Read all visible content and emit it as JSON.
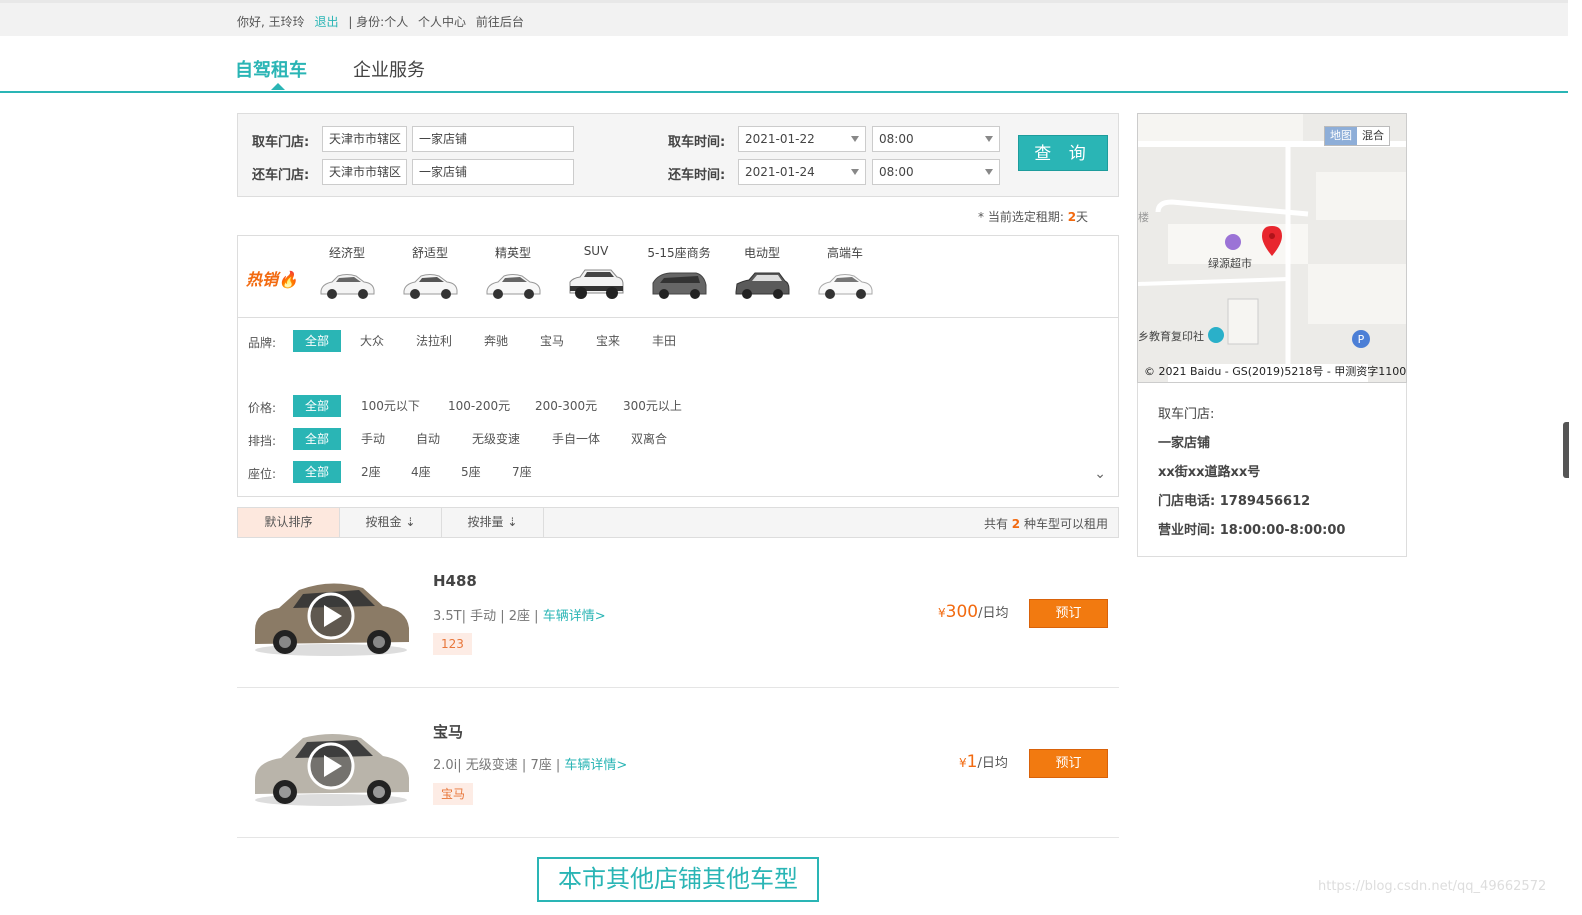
{
  "topbar": {
    "greeting": "你好, 王玲玲",
    "logout": "退出",
    "identity": "| 身份:个人",
    "personal_center": "个人中心",
    "backend": "前往后台"
  },
  "nav": {
    "tabs": [
      {
        "label": "自驾租车",
        "active": true
      },
      {
        "label": "企业服务",
        "active": false
      }
    ]
  },
  "search": {
    "pickup_store_label": "取车门店:",
    "return_store_label": "还车门店:",
    "pickup_city": "天津市市辖区",
    "pickup_store": "一家店铺",
    "return_city": "天津市市辖区",
    "return_store": "一家店铺",
    "pickup_time_label": "取车时间:",
    "return_time_label": "还车时间:",
    "pickup_date": "2021-01-22",
    "pickup_hour": "08:00",
    "return_date": "2021-01-24",
    "return_hour": "08:00",
    "query_button": "查 询"
  },
  "period": {
    "prefix": "* 当前选定租期:",
    "days": "2",
    "unit": "天"
  },
  "categories": {
    "hot_label": "热销",
    "items": [
      "经济型",
      "舒适型",
      "精英型",
      "SUV",
      "5-15座商务",
      "电动型",
      "高端车"
    ]
  },
  "filters": {
    "brand": {
      "label": "品牌:",
      "options": [
        "全部",
        "大众",
        "法拉利",
        "奔驰",
        "宝马",
        "宝来",
        "丰田"
      ]
    },
    "price": {
      "label": "价格:",
      "options": [
        "全部",
        "100元以下",
        "100-200元",
        "200-300元",
        "300元以上"
      ]
    },
    "gear": {
      "label": "排挡:",
      "options": [
        "全部",
        "手动",
        "自动",
        "无级变速",
        "手自一体",
        "双离合"
      ]
    },
    "seats": {
      "label": "座位:",
      "options": [
        "全部",
        "2座",
        "4座",
        "5座",
        "7座"
      ]
    }
  },
  "sort": {
    "default": "默认排序",
    "by_rent": "按租金",
    "by_disp": "按排量",
    "total_prefix": "共有",
    "total_count": "2",
    "total_suffix": "种车型可以租用"
  },
  "cars": [
    {
      "title": "H488",
      "specs": "3.5T| 手动 | 2座 |",
      "detail_link": "车辆详情>",
      "tag": "123",
      "currency": "¥",
      "price": "300",
      "price_unit": "/日均",
      "book": "预订",
      "color": "#8b7b66"
    },
    {
      "title": "宝马",
      "specs": "2.0i| 无级变速 | 7座 |",
      "detail_link": "车辆详情>",
      "tag": "宝马",
      "currency": "¥",
      "price": "1",
      "price_unit": "/日均",
      "book": "预订",
      "color": "#a9a49a"
    }
  ],
  "other_button": "本市其他店铺其他车型",
  "map": {
    "toggle_map": "地图",
    "toggle_mixed": "混合",
    "poi_supermarket": "绿源超市",
    "poi_print": "乡教育复印社",
    "poi_building": "楼",
    "copyright": "© 2021 Baidu - GS(2019)5218号 - 甲测资字11009"
  },
  "store_info": {
    "pickup_label": "取车门店:",
    "name": "一家店铺",
    "address": "xx街xx道路xx号",
    "phone": "门店电话: 1789456612",
    "hours": "营业时间: 18:00:00-8:00:00"
  },
  "watermark": "https://blog.csdn.net/qq_49662572",
  "colors": {
    "accent": "#2ab5b5",
    "orange": "#f27a10"
  }
}
